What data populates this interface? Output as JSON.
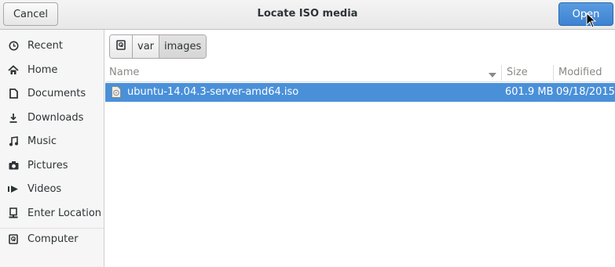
{
  "header": {
    "title": "Locate ISO media",
    "cancel_label": "Cancel",
    "open_label": "Open"
  },
  "sidebar": {
    "items": [
      {
        "label": "Recent",
        "icon": "clock-icon"
      },
      {
        "label": "Home",
        "icon": "home-icon"
      },
      {
        "label": "Documents",
        "icon": "document-icon"
      },
      {
        "label": "Downloads",
        "icon": "download-icon"
      },
      {
        "label": "Music",
        "icon": "music-icon"
      },
      {
        "label": "Pictures",
        "icon": "camera-icon"
      },
      {
        "label": "Videos",
        "icon": "video-icon"
      },
      {
        "label": "Enter Location",
        "icon": "location-icon"
      },
      {
        "label": "Computer",
        "icon": "computer-icon"
      }
    ]
  },
  "pathbar": {
    "segments": [
      "var",
      "images"
    ]
  },
  "columns": {
    "name": "Name",
    "size": "Size",
    "modified": "Modified"
  },
  "files": [
    {
      "name": "ubuntu-14.04.3-server-amd64.iso",
      "size": "601.9 MB",
      "modified": "09/18/2015",
      "selected": true
    }
  ],
  "colors": {
    "selection": "#4a90d9",
    "accent": "#3d83d1"
  }
}
